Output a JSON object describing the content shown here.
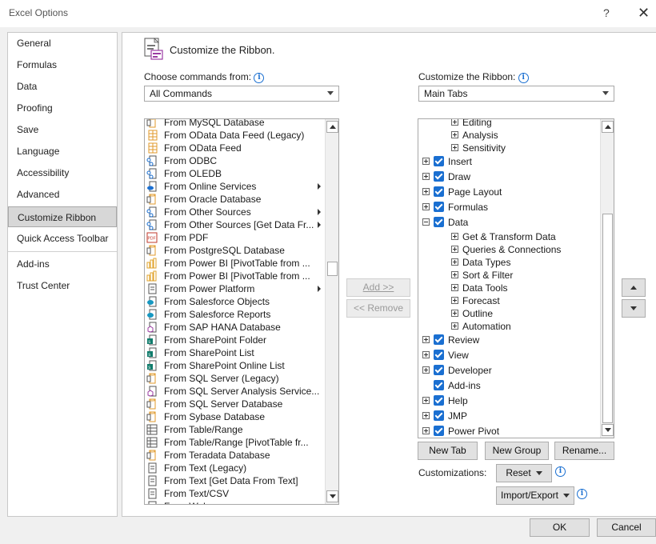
{
  "window": {
    "title": "Excel Options",
    "help_glyph": "?",
    "close_glyph": "✕"
  },
  "nav": {
    "group1": [
      {
        "label": "General"
      },
      {
        "label": "Formulas"
      },
      {
        "label": "Data"
      },
      {
        "label": "Proofing"
      },
      {
        "label": "Save"
      },
      {
        "label": "Language"
      },
      {
        "label": "Accessibility"
      },
      {
        "label": "Advanced"
      }
    ],
    "group2": [
      {
        "label": "Customize Ribbon",
        "selected": true
      },
      {
        "label": "Quick Access Toolbar"
      }
    ],
    "group3": [
      {
        "label": "Add-ins"
      },
      {
        "label": "Trust Center"
      }
    ]
  },
  "page": {
    "heading": "Customize the Ribbon."
  },
  "choose": {
    "label": "Choose commands from:",
    "value": "All Commands"
  },
  "customize": {
    "label": "Customize the Ribbon:",
    "value": "Main Tabs"
  },
  "commands": [
    {
      "label": "From MySQL Database",
      "icon": "db-icon"
    },
    {
      "label": "From OData Data Feed (Legacy)",
      "icon": "table-icon"
    },
    {
      "label": "From OData Feed",
      "icon": "table-icon"
    },
    {
      "label": "From ODBC",
      "icon": "link-icon"
    },
    {
      "label": "From OLEDB",
      "icon": "link-icon"
    },
    {
      "label": "From Online Services",
      "icon": "cloud-icon",
      "submenu": true
    },
    {
      "label": "From Oracle Database",
      "icon": "db-icon"
    },
    {
      "label": "From Other Sources",
      "icon": "link-icon",
      "submenu": true
    },
    {
      "label": "From Other Sources [Get Data Fr...",
      "icon": "link-icon",
      "submenu": true
    },
    {
      "label": "From PDF",
      "icon": "pdf-icon"
    },
    {
      "label": "From PostgreSQL Database",
      "icon": "db-icon"
    },
    {
      "label": "From Power BI [PivotTable from ...",
      "icon": "powerbi-icon"
    },
    {
      "label": "From Power BI [PivotTable from ...",
      "icon": "powerbi-icon"
    },
    {
      "label": "From Power Platform",
      "icon": "doc-icon",
      "submenu": true
    },
    {
      "label": "From Salesforce Objects",
      "icon": "salesforce-icon"
    },
    {
      "label": "From Salesforce Reports",
      "icon": "salesforce-icon"
    },
    {
      "label": "From SAP HANA Database",
      "icon": "cube-icon"
    },
    {
      "label": "From SharePoint Folder",
      "icon": "sharepoint-icon"
    },
    {
      "label": "From SharePoint List",
      "icon": "sharepoint-icon"
    },
    {
      "label": "From SharePoint Online List",
      "icon": "sharepoint-icon"
    },
    {
      "label": "From SQL Server (Legacy)",
      "icon": "db-icon"
    },
    {
      "label": "From SQL Server Analysis Service...",
      "icon": "cube-icon"
    },
    {
      "label": "From SQL Server Database",
      "icon": "db-icon"
    },
    {
      "label": "From Sybase Database",
      "icon": "db-icon"
    },
    {
      "label": "From Table/Range",
      "icon": "grid-icon"
    },
    {
      "label": "From Table/Range [PivotTable fr...",
      "icon": "grid-icon"
    },
    {
      "label": "From Teradata Database",
      "icon": "db-icon"
    },
    {
      "label": "From Text (Legacy)",
      "icon": "doc-icon"
    },
    {
      "label": "From Text [Get Data From Text]",
      "icon": "doc-icon"
    },
    {
      "label": "From Text/CSV",
      "icon": "doc-icon"
    },
    {
      "label": "From Web",
      "icon": "doc-icon"
    }
  ],
  "buttons": {
    "add": "Add >>",
    "remove": "<< Remove",
    "new_tab": "New Tab",
    "new_group": "New Group",
    "rename": "Rename...",
    "reset": "Reset",
    "import_export": "Import/Export",
    "ok": "OK",
    "cancel": "Cancel"
  },
  "customizations_label": "Customizations:",
  "tree": [
    {
      "label": "Editing",
      "level": 2,
      "expand": "plus"
    },
    {
      "label": "Analysis",
      "level": 2,
      "expand": "plus"
    },
    {
      "label": "Sensitivity",
      "level": 2,
      "expand": "plus"
    },
    {
      "label": "Insert",
      "level": 1,
      "expand": "plus",
      "checked": true
    },
    {
      "label": "Draw",
      "level": 1,
      "expand": "plus",
      "checked": true
    },
    {
      "label": "Page Layout",
      "level": 1,
      "expand": "plus",
      "checked": true
    },
    {
      "label": "Formulas",
      "level": 1,
      "expand": "plus",
      "checked": true
    },
    {
      "label": "Data",
      "level": 1,
      "expand": "minus",
      "checked": true
    },
    {
      "label": "Get & Transform Data",
      "level": 2,
      "expand": "plus"
    },
    {
      "label": "Queries & Connections",
      "level": 2,
      "expand": "plus"
    },
    {
      "label": "Data Types",
      "level": 2,
      "expand": "plus"
    },
    {
      "label": "Sort & Filter",
      "level": 2,
      "expand": "plus"
    },
    {
      "label": "Data Tools",
      "level": 2,
      "expand": "plus"
    },
    {
      "label": "Forecast",
      "level": 2,
      "expand": "plus"
    },
    {
      "label": "Outline",
      "level": 2,
      "expand": "plus"
    },
    {
      "label": "Automation",
      "level": 2,
      "expand": "plus"
    },
    {
      "label": "Review",
      "level": 1,
      "expand": "plus",
      "checked": true
    },
    {
      "label": "View",
      "level": 1,
      "expand": "plus",
      "checked": true
    },
    {
      "label": "Developer",
      "level": 1,
      "expand": "plus",
      "checked": true
    },
    {
      "label": "Add-ins",
      "level": 1,
      "expand": "none",
      "checked": true
    },
    {
      "label": "Help",
      "level": 1,
      "expand": "plus",
      "checked": true
    },
    {
      "label": "JMP",
      "level": 1,
      "expand": "plus",
      "checked": true
    },
    {
      "label": "Power Pivot",
      "level": 1,
      "expand": "plus",
      "checked": true
    }
  ],
  "colors": {
    "accent": "#1a6fd1",
    "selected_nav": "#d7d7d7"
  }
}
